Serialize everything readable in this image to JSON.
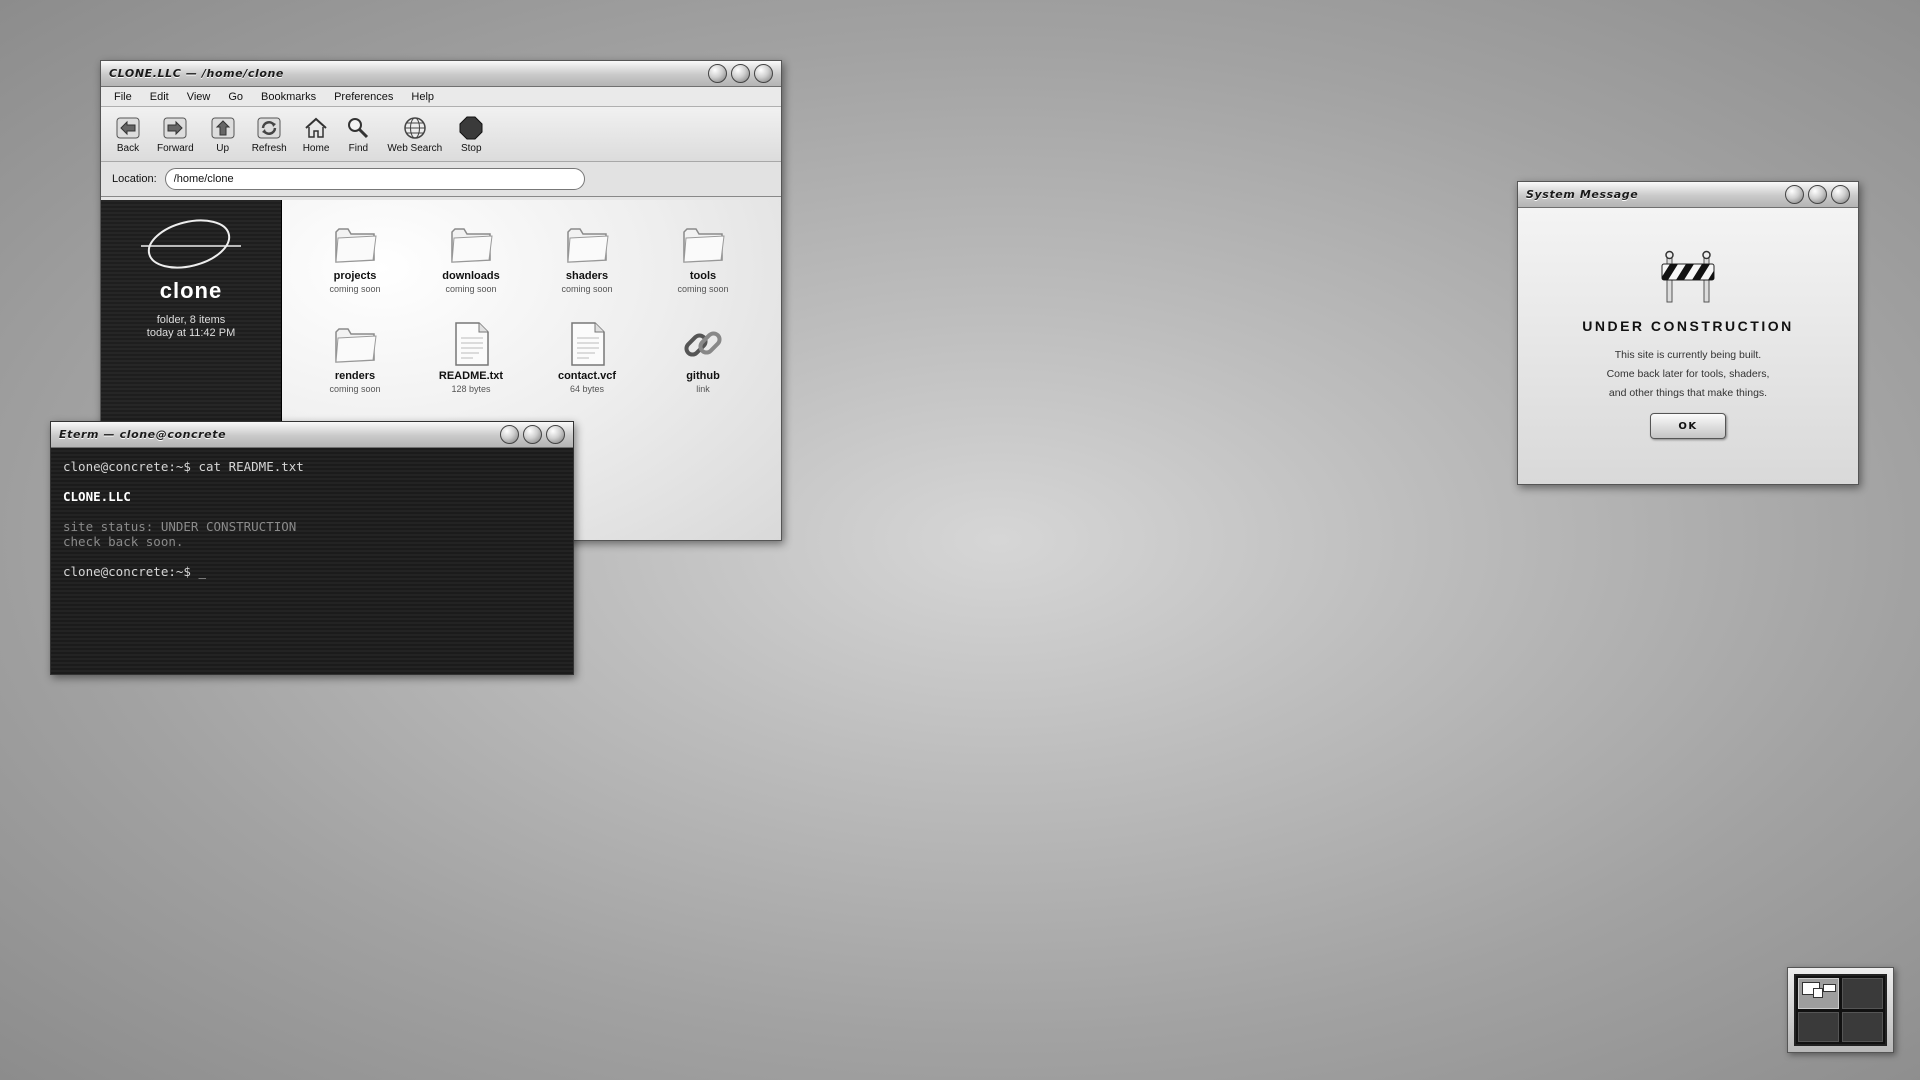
{
  "file_manager": {
    "title": "CLONE.LLC — /home/clone",
    "menu": [
      "File",
      "Edit",
      "View",
      "Go",
      "Bookmarks",
      "Preferences",
      "Help"
    ],
    "toolbar": [
      {
        "label": "Back",
        "icon": "back-arrow-icon"
      },
      {
        "label": "Forward",
        "icon": "forward-arrow-icon"
      },
      {
        "label": "Up",
        "icon": "up-arrow-icon"
      },
      {
        "label": "Refresh",
        "icon": "refresh-icon"
      },
      {
        "label": "Home",
        "icon": "home-icon"
      },
      {
        "label": "Find",
        "icon": "magnifier-icon"
      },
      {
        "label": "Web Search",
        "icon": "globe-icon"
      },
      {
        "label": "Stop",
        "icon": "stop-sign-icon"
      }
    ],
    "location_label": "Location:",
    "location_value": "/home/clone",
    "sidebar": {
      "name": "clone",
      "meta_line1": "folder, 8 items",
      "meta_line2": "today at 11:42 PM"
    },
    "items": [
      {
        "name": "projects",
        "sub": "coming soon",
        "icon": "folder-icon"
      },
      {
        "name": "downloads",
        "sub": "coming soon",
        "icon": "folder-icon"
      },
      {
        "name": "shaders",
        "sub": "coming soon",
        "icon": "folder-icon"
      },
      {
        "name": "tools",
        "sub": "coming soon",
        "icon": "folder-icon"
      },
      {
        "name": "renders",
        "sub": "coming soon",
        "icon": "folder-icon"
      },
      {
        "name": "README.txt",
        "sub": "128 bytes",
        "icon": "document-icon"
      },
      {
        "name": "contact.vcf",
        "sub": "64 bytes",
        "icon": "document-icon"
      },
      {
        "name": "github",
        "sub": "link",
        "icon": "chain-link-icon"
      }
    ]
  },
  "terminal": {
    "title": "Eterm — clone@concrete",
    "lines": [
      "clone@concrete:~$ cat README.txt",
      "",
      "CLONE.LLC",
      "",
      "site status: UNDER CONSTRUCTION",
      "check back soon.",
      "",
      "clone@concrete:~$ _"
    ]
  },
  "dialog": {
    "title": "System Message",
    "heading": "UNDER CONSTRUCTION",
    "line1": "This site is currently being built.",
    "line2": "Come back later for tools, shaders,",
    "line3": "and other things that make things.",
    "ok_label": "OK"
  }
}
